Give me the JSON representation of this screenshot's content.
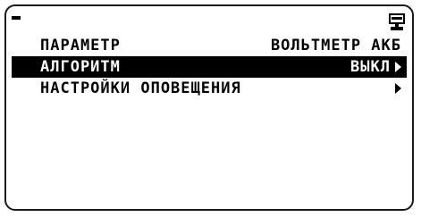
{
  "status_bar": {
    "left_glyph": "-",
    "right_icon": "device-icon"
  },
  "menu": {
    "items": [
      {
        "label": "ПАРАМЕТР",
        "value": "ВОЛЬТМЕТР АКБ",
        "has_arrow": false,
        "selected": false
      },
      {
        "label": "АЛГОРИТМ",
        "value": "ВЫКЛ",
        "has_arrow": true,
        "selected": true
      },
      {
        "label": "НАСТРОЙКИ ОПОВЕЩЕНИЯ",
        "value": "",
        "has_arrow": true,
        "selected": false
      }
    ]
  },
  "colors": {
    "foreground": "#000000",
    "background": "#ffffff",
    "selection": "#000000"
  }
}
